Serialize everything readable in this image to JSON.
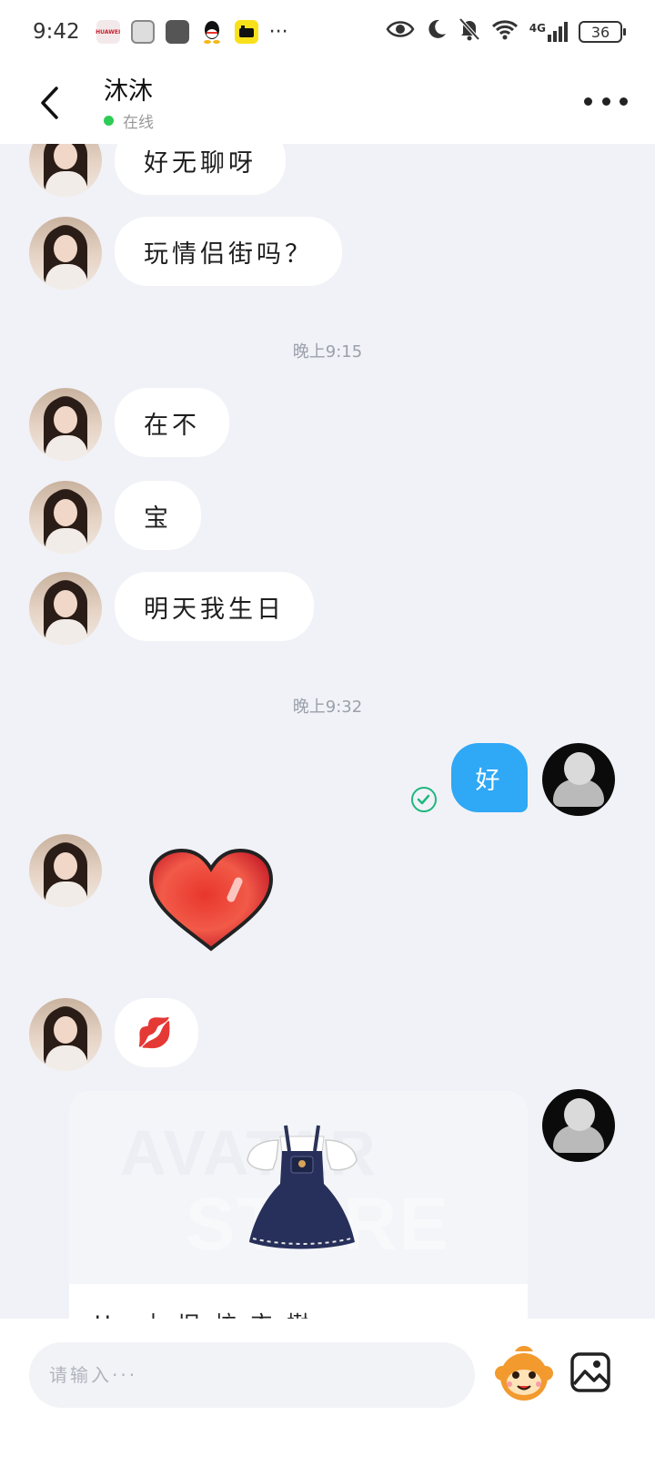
{
  "status_bar": {
    "time": "9:42",
    "more_indicator": "···",
    "network": "4G",
    "battery": "36",
    "huawei_label": "HUAWEI"
  },
  "header": {
    "contact_name": "沐沐",
    "status_text": "在线"
  },
  "messages": [
    {
      "from": "them",
      "text": "好无聊呀"
    },
    {
      "from": "them",
      "text": "玩情侣街吗？"
    },
    {
      "type": "time",
      "text": "晚上9:15"
    },
    {
      "from": "them",
      "text": "在不"
    },
    {
      "from": "them",
      "text": "宝"
    },
    {
      "from": "them",
      "text": "明天我生日"
    },
    {
      "type": "time",
      "text": "晚上9:32"
    },
    {
      "from": "me",
      "text": "好",
      "status": "read"
    },
    {
      "from": "them",
      "type": "sticker",
      "sticker": "heart"
    },
    {
      "from": "them",
      "type": "emoji",
      "emoji": "💋"
    },
    {
      "from": "me",
      "type": "card",
      "watermark_line1": "AVATAR",
      "watermark_line2": "STORE",
      "caption": "Ug.小 旧 坊 衣 樹"
    }
  ],
  "input": {
    "placeholder": "请输入···"
  },
  "colors": {
    "accent": "#2fa8f5",
    "online": "#2ecc55",
    "read_check": "#1fb77d",
    "background": "#f1f2f7"
  }
}
